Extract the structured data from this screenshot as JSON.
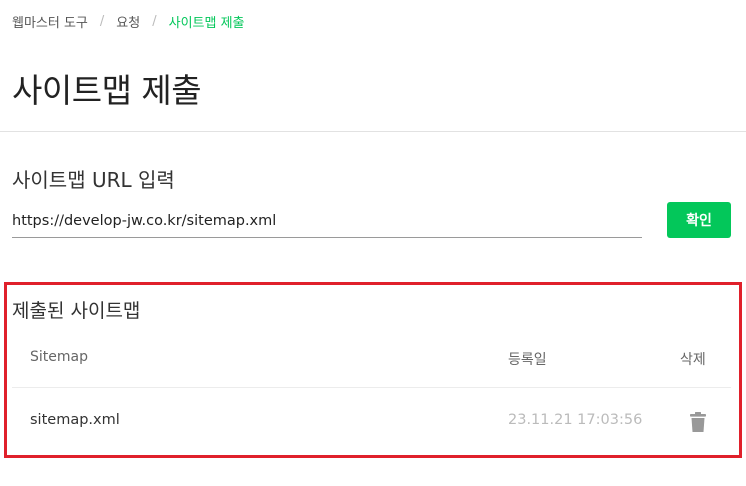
{
  "breadcrumb": {
    "items": [
      "웹마스터 도구",
      "요청",
      "사이트맵 제출"
    ],
    "separator": "/"
  },
  "page_title": "사이트맵 제출",
  "url_section": {
    "label": "사이트맵 URL 입력",
    "input_value": "https://develop-jw.co.kr/sitemap.xml",
    "confirm_label": "확인"
  },
  "submitted": {
    "title": "제출된 사이트맵",
    "columns": {
      "sitemap": "Sitemap",
      "date": "등록일",
      "delete": "삭제"
    },
    "rows": [
      {
        "sitemap": "sitemap.xml",
        "date": "23.11.21 17:03:56",
        "delete_icon": "trash-icon"
      }
    ]
  },
  "colors": {
    "accent": "#03c75a",
    "highlight_border": "#e0202b",
    "muted_text": "#bbbbbb"
  }
}
